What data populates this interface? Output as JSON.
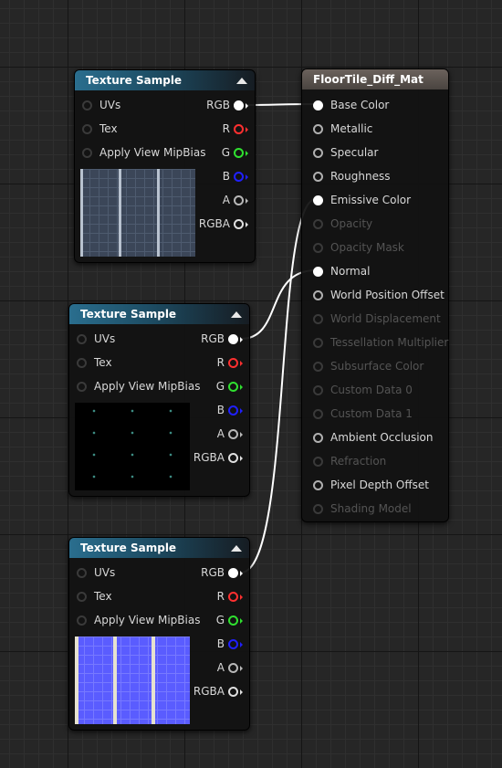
{
  "texture_nodes": [
    {
      "title": "Texture Sample",
      "inputs": [
        "UVs",
        "Tex",
        "Apply View MipBias"
      ],
      "outputs": [
        "RGB",
        "R",
        "G",
        "B",
        "A",
        "RGBA"
      ],
      "preview": "dark-blue-grid-tiles"
    },
    {
      "title": "Texture Sample",
      "inputs": [
        "UVs",
        "Tex",
        "Apply View MipBias"
      ],
      "outputs": [
        "RGB",
        "R",
        "G",
        "B",
        "A",
        "RGBA"
      ],
      "preview": "black-with-teal-dots"
    },
    {
      "title": "Texture Sample",
      "inputs": [
        "UVs",
        "Tex",
        "Apply View MipBias"
      ],
      "outputs": [
        "RGB",
        "R",
        "G",
        "B",
        "A",
        "RGBA"
      ],
      "preview": "blue-normal-map-tiles"
    }
  ],
  "material_node": {
    "title": "FloorTile_Diff_Mat",
    "inputs": [
      {
        "label": "Base Color",
        "enabled": true,
        "connected": true
      },
      {
        "label": "Metallic",
        "enabled": true,
        "connected": false
      },
      {
        "label": "Specular",
        "enabled": true,
        "connected": false
      },
      {
        "label": "Roughness",
        "enabled": true,
        "connected": false
      },
      {
        "label": "Emissive Color",
        "enabled": true,
        "connected": true
      },
      {
        "label": "Opacity",
        "enabled": false,
        "connected": false
      },
      {
        "label": "Opacity Mask",
        "enabled": false,
        "connected": false
      },
      {
        "label": "Normal",
        "enabled": true,
        "connected": true
      },
      {
        "label": "World Position Offset",
        "enabled": true,
        "connected": false
      },
      {
        "label": "World Displacement",
        "enabled": false,
        "connected": false
      },
      {
        "label": "Tessellation Multiplier",
        "enabled": false,
        "connected": false
      },
      {
        "label": "Subsurface Color",
        "enabled": false,
        "connected": false
      },
      {
        "label": "Custom Data 0",
        "enabled": false,
        "connected": false
      },
      {
        "label": "Custom Data 1",
        "enabled": false,
        "connected": false
      },
      {
        "label": "Ambient Occlusion",
        "enabled": true,
        "connected": false
      },
      {
        "label": "Refraction",
        "enabled": false,
        "connected": false
      },
      {
        "label": "Pixel Depth Offset",
        "enabled": true,
        "connected": false
      },
      {
        "label": "Shading Model",
        "enabled": false,
        "connected": false
      }
    ]
  },
  "pin_colors": {
    "RGB": "#ffffff",
    "R": "#ff3030",
    "G": "#30e030",
    "B": "#2020ff",
    "A": "#b8b8b8",
    "RGBA": "#e0e0e0"
  },
  "connections": [
    {
      "from": "texture_nodes.0.RGB",
      "to": "Base Color"
    },
    {
      "from": "texture_nodes.1.RGB",
      "to": "Normal"
    },
    {
      "from": "texture_nodes.2.RGB",
      "to": "Emissive Color"
    }
  ]
}
